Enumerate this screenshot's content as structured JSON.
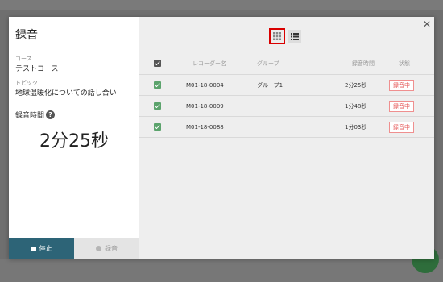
{
  "left_panel": {
    "title": "録音",
    "course_label": "コース",
    "course_value": "テストコース",
    "topic_label": "トピック",
    "topic_value": "地球温暖化についての話し合い",
    "duration_label": "録音時間",
    "duration_value": "2分25秒",
    "stop_label": "停止",
    "record_label": "録音"
  },
  "table": {
    "headers": {
      "name": "レコーダー名",
      "group": "グループ",
      "time": "録音時間",
      "status": "状態"
    },
    "rows": [
      {
        "name": "M01-18-0004",
        "group": "グループ1",
        "time": "2分25秒",
        "status": "録音中"
      },
      {
        "name": "M01-18-0009",
        "group": "",
        "time": "1分48秒",
        "status": "録音中"
      },
      {
        "name": "M01-18-0088",
        "group": "",
        "time": "1分03秒",
        "status": "録音中"
      }
    ]
  },
  "icons": {
    "close": "close-icon",
    "grid_view": "grid-view-icon",
    "list_view": "list-view-icon",
    "help": "help-icon"
  },
  "colors": {
    "stop_button": "#2d6477",
    "checkbox_green": "#5ba36c",
    "status_red": "#e65c5c",
    "highlight_red": "#d90000"
  }
}
